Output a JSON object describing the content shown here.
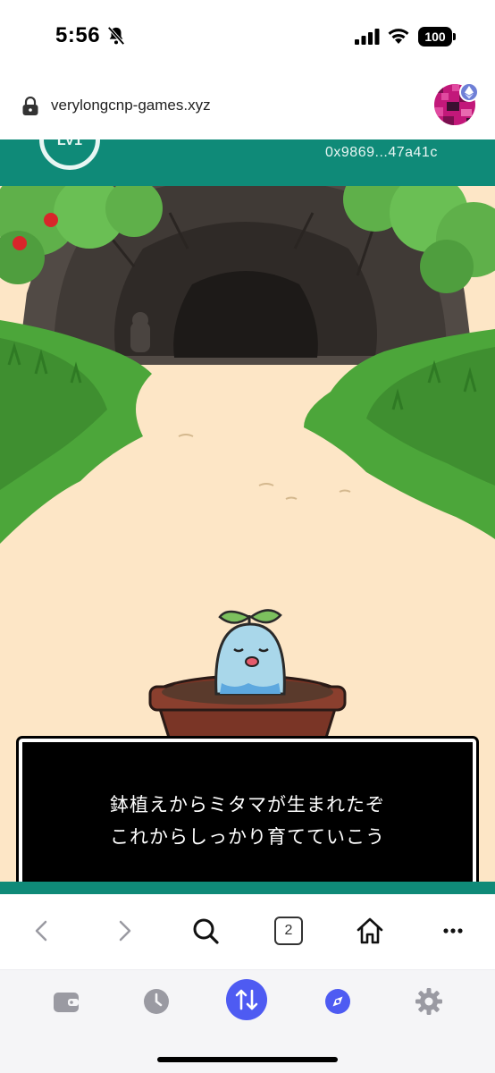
{
  "status_bar": {
    "time": "5:56",
    "battery": "100",
    "icons": [
      "bell-slash-icon",
      "signal-icon",
      "wifi-icon",
      "battery-icon"
    ]
  },
  "browser": {
    "url": "verylongcnp-games.xyz",
    "tab_count": "2",
    "toolbar_icons": [
      "back-icon",
      "forward-icon",
      "search-icon",
      "tabs-icon",
      "home-icon",
      "more-icon"
    ]
  },
  "game": {
    "level_label": "LV1",
    "wallet_address": "0x9869...47a41c",
    "dialog": {
      "line1": "鉢植えからミタマが生まれたぞ",
      "line2": "これからしっかり育てていこう"
    },
    "colors": {
      "header": "#0f8a78",
      "path": "#fde6c6",
      "grass": "#4ca63a",
      "cave": "#3f3a36",
      "pot": "#7a3526",
      "character": "#a9d7ea"
    }
  },
  "wallet_nav": {
    "items": [
      "wallet-icon",
      "history-icon",
      "swap-icon",
      "browser-compass-icon",
      "settings-icon"
    ],
    "active": "swap-icon",
    "accent": "#4e5bf2"
  }
}
